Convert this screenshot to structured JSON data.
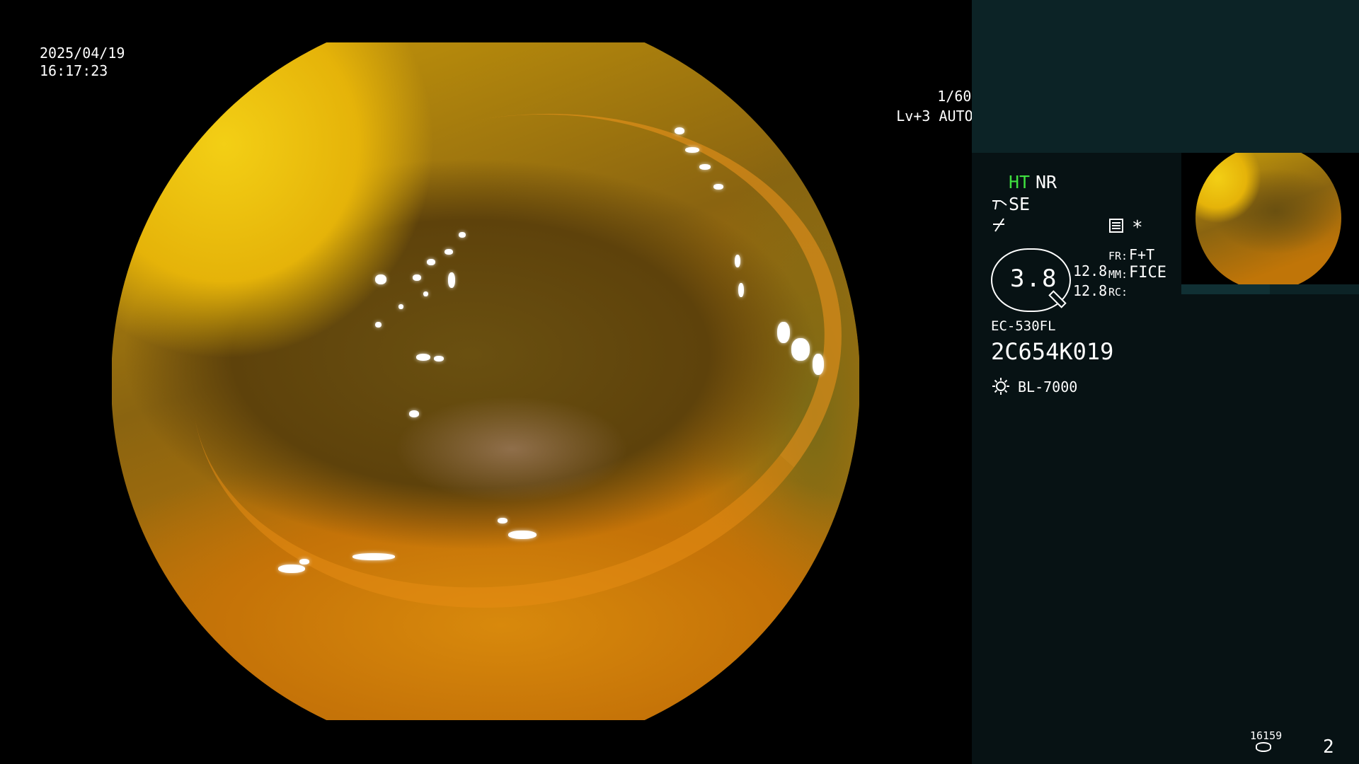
{
  "osd": {
    "date": "2025/04/19",
    "time": "16:17:23",
    "shutter": "1/60",
    "exposure": "Lv+3 AUTO",
    "shutter_icon": "shutter-icon",
    "iris_icon": "iris-icon"
  },
  "panel": {
    "ht": "HT",
    "nr": "NR",
    "se": "SE",
    "asterisk": "*",
    "magnification": "3.8",
    "mag_value_1": "12.8",
    "mag_value_2": "12.8",
    "fr_label": "FR:",
    "fr_value": "F+T",
    "mm_label": "MM:",
    "mm_value": "FICE",
    "rc_label": "RC:",
    "scope_model": "EC-530FL",
    "scope_serial": "2C654K019",
    "light_source": "BL-7000",
    "counter": "16159",
    "page_number": "2"
  },
  "colors": {
    "panel_bg": "#071214",
    "panel_header_bg": "#0c2326",
    "ht_green": "#3fe03f"
  }
}
